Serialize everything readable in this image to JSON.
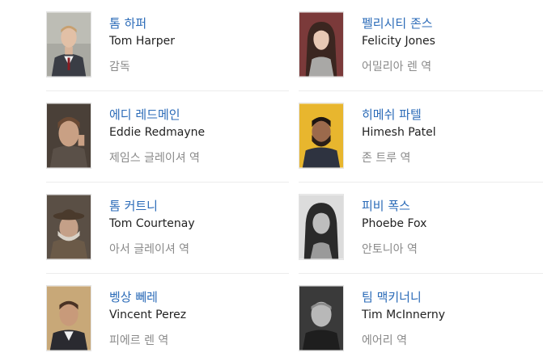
{
  "cast": [
    {
      "name_ko": "톰 하퍼",
      "name_en": "Tom Harper",
      "role": "감독",
      "photo_icon": "person-photo"
    },
    {
      "name_ko": "펠리시티 존스",
      "name_en": "Felicity Jones",
      "role": "어밀리아 렌 역",
      "photo_icon": "person-photo"
    },
    {
      "name_ko": "에디 레드메인",
      "name_en": "Eddie Redmayne",
      "role": "제임스 글레이셔 역",
      "photo_icon": "person-photo"
    },
    {
      "name_ko": "히메쉬 파텔",
      "name_en": "Himesh Patel",
      "role": "존 트루 역",
      "photo_icon": "person-photo"
    },
    {
      "name_ko": "톰 커트니",
      "name_en": "Tom Courtenay",
      "role": "아서 글레이셔 역",
      "photo_icon": "person-photo"
    },
    {
      "name_ko": "피비 폭스",
      "name_en": "Phoebe Fox",
      "role": "안토니아 역",
      "photo_icon": "person-photo"
    },
    {
      "name_ko": "벵상 뻬레",
      "name_en": "Vincent Perez",
      "role": "피에르 렌 역",
      "photo_icon": "person-photo"
    },
    {
      "name_ko": "팀 맥키너니",
      "name_en": "Tim McInnerny",
      "role": "에어리 역",
      "photo_icon": "person-photo"
    }
  ]
}
